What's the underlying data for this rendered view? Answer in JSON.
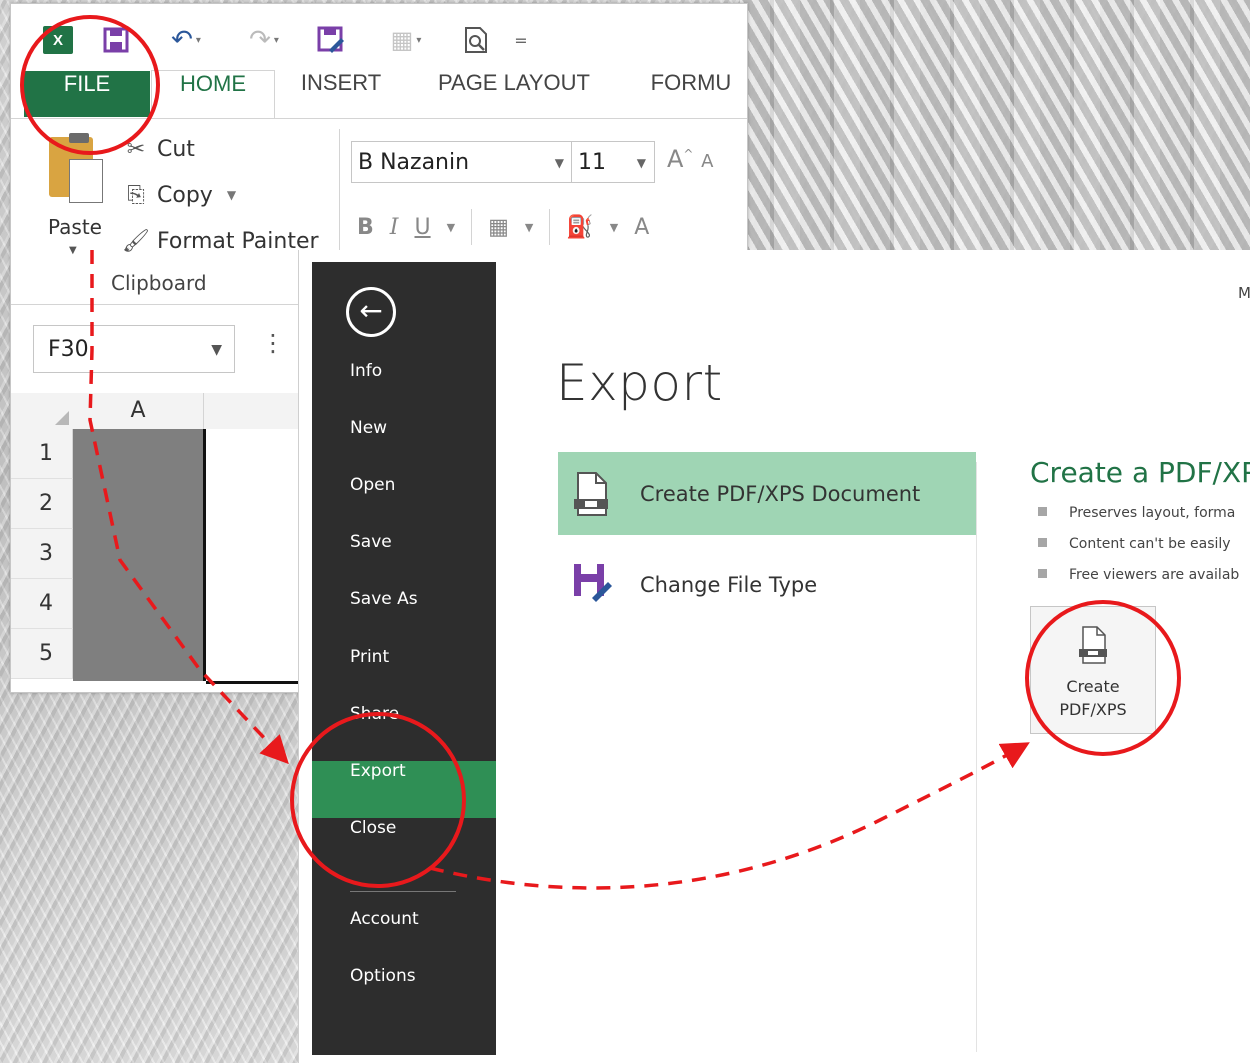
{
  "excel": {
    "qat": {
      "logo_text": "X",
      "dropdown_glyph": "▾",
      "customize_glyph": "="
    },
    "tabs": [
      "FILE",
      "HOME",
      "INSERT",
      "PAGE LAYOUT",
      "FORMU"
    ],
    "clipboard": {
      "paste_label": "Paste",
      "cut_label": "Cut",
      "copy_label": "Copy",
      "format_painter_label": "Format Painter",
      "group_label": "Clipboard"
    },
    "font": {
      "name": "B Nazanin",
      "size": "11",
      "grow_glyph": "A",
      "shrink_glyph": "A",
      "bold": "B",
      "italic": "I",
      "underline": "U",
      "font_color_glyph": "A"
    },
    "name_box": "F30",
    "formula_dots": "⋮",
    "column_header": "A",
    "row_headers": [
      "1",
      "2",
      "3",
      "4",
      "5"
    ]
  },
  "backstage": {
    "back_glyph": "←",
    "nav": [
      "Info",
      "New",
      "Open",
      "Save",
      "Save As",
      "Print",
      "Share",
      "Export",
      "Close",
      "Account",
      "Options"
    ],
    "active_nav": "Export",
    "user_name": "ME",
    "title": "Export",
    "options": [
      {
        "label": "Create PDF/XPS Document",
        "icon": "pdf-document-icon",
        "selected": true
      },
      {
        "label": "Change File Type",
        "icon": "change-file-type-icon",
        "selected": false
      }
    ],
    "right_panel": {
      "title": "Create a PDF/XP",
      "bullets": [
        "Preserves layout, forma",
        "Content can't be easily",
        "Free viewers are availab"
      ],
      "button_line1": "Create",
      "button_line2": "PDF/XPS"
    }
  },
  "colors": {
    "excel_green": "#217346",
    "backstage_nav": "#2d2d2d",
    "export_active": "#2f8f55",
    "selected_option": "#9fd5b4",
    "annotation_red": "#e8191c"
  }
}
